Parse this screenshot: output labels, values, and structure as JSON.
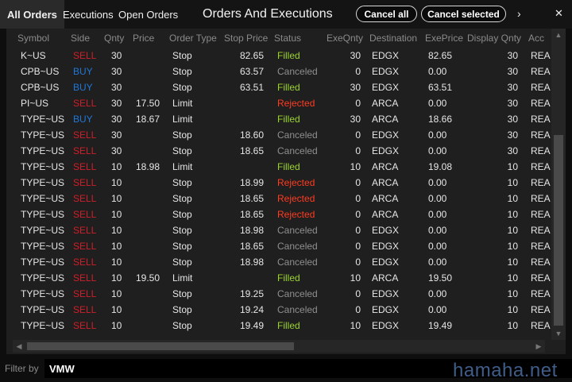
{
  "tabs": [
    {
      "label": "All Orders",
      "active": true
    },
    {
      "label": "Executions",
      "active": false
    },
    {
      "label": "Open Orders",
      "active": false
    }
  ],
  "window_title": "Orders And Executions",
  "actions": {
    "cancel_all": "Cancel all",
    "cancel_selected": "Cancel selected",
    "more_glyph": "›",
    "close_glyph": "✕"
  },
  "columns": [
    "Symbol",
    "Side",
    "Qnty",
    "Price",
    "Order Type",
    "Stop Price",
    "Status",
    "ExeQnty",
    "Destination",
    "ExePrice",
    "Display Qnty",
    "Acc"
  ],
  "rows": [
    {
      "symbol": "K~US",
      "side": "SELL",
      "qnty": "30",
      "price": "",
      "type": "Stop",
      "stop": "82.65",
      "status": "Filled",
      "exeqnty": "30",
      "dest": "EDGX",
      "exeprice": "82.65",
      "display": "30",
      "acc": "REA"
    },
    {
      "symbol": "CPB~US",
      "side": "BUY",
      "qnty": "30",
      "price": "",
      "type": "Stop",
      "stop": "63.57",
      "status": "Canceled",
      "exeqnty": "0",
      "dest": "EDGX",
      "exeprice": "0.00",
      "display": "30",
      "acc": "REA"
    },
    {
      "symbol": "CPB~US",
      "side": "BUY",
      "qnty": "30",
      "price": "",
      "type": "Stop",
      "stop": "63.51",
      "status": "Filled",
      "exeqnty": "30",
      "dest": "EDGX",
      "exeprice": "63.51",
      "display": "30",
      "acc": "REA"
    },
    {
      "symbol": "PI~US",
      "side": "SELL",
      "qnty": "30",
      "price": "17.50",
      "type": "Limit",
      "stop": "",
      "status": "Rejected",
      "exeqnty": "0",
      "dest": "ARCA",
      "exeprice": "0.00",
      "display": "30",
      "acc": "REA"
    },
    {
      "symbol": "TYPE~US",
      "side": "BUY",
      "qnty": "30",
      "price": "18.67",
      "type": "Limit",
      "stop": "",
      "status": "Filled",
      "exeqnty": "30",
      "dest": "ARCA",
      "exeprice": "18.66",
      "display": "30",
      "acc": "REA"
    },
    {
      "symbol": "TYPE~US",
      "side": "SELL",
      "qnty": "30",
      "price": "",
      "type": "Stop",
      "stop": "18.60",
      "status": "Canceled",
      "exeqnty": "0",
      "dest": "EDGX",
      "exeprice": "0.00",
      "display": "30",
      "acc": "REA"
    },
    {
      "symbol": "TYPE~US",
      "side": "SELL",
      "qnty": "30",
      "price": "",
      "type": "Stop",
      "stop": "18.65",
      "status": "Canceled",
      "exeqnty": "0",
      "dest": "EDGX",
      "exeprice": "0.00",
      "display": "30",
      "acc": "REA"
    },
    {
      "symbol": "TYPE~US",
      "side": "SELL",
      "qnty": "10",
      "price": "18.98",
      "type": "Limit",
      "stop": "",
      "status": "Filled",
      "exeqnty": "10",
      "dest": "ARCA",
      "exeprice": "19.08",
      "display": "10",
      "acc": "REA"
    },
    {
      "symbol": "TYPE~US",
      "side": "SELL",
      "qnty": "10",
      "price": "",
      "type": "Stop",
      "stop": "18.99",
      "status": "Rejected",
      "exeqnty": "0",
      "dest": "ARCA",
      "exeprice": "0.00",
      "display": "10",
      "acc": "REA"
    },
    {
      "symbol": "TYPE~US",
      "side": "SELL",
      "qnty": "10",
      "price": "",
      "type": "Stop",
      "stop": "18.65",
      "status": "Rejected",
      "exeqnty": "0",
      "dest": "ARCA",
      "exeprice": "0.00",
      "display": "10",
      "acc": "REA"
    },
    {
      "symbol": "TYPE~US",
      "side": "SELL",
      "qnty": "10",
      "price": "",
      "type": "Stop",
      "stop": "18.65",
      "status": "Rejected",
      "exeqnty": "0",
      "dest": "ARCA",
      "exeprice": "0.00",
      "display": "10",
      "acc": "REA"
    },
    {
      "symbol": "TYPE~US",
      "side": "SELL",
      "qnty": "10",
      "price": "",
      "type": "Stop",
      "stop": "18.98",
      "status": "Canceled",
      "exeqnty": "0",
      "dest": "EDGX",
      "exeprice": "0.00",
      "display": "10",
      "acc": "REA"
    },
    {
      "symbol": "TYPE~US",
      "side": "SELL",
      "qnty": "10",
      "price": "",
      "type": "Stop",
      "stop": "18.65",
      "status": "Canceled",
      "exeqnty": "0",
      "dest": "EDGX",
      "exeprice": "0.00",
      "display": "10",
      "acc": "REA"
    },
    {
      "symbol": "TYPE~US",
      "side": "SELL",
      "qnty": "10",
      "price": "",
      "type": "Stop",
      "stop": "18.98",
      "status": "Canceled",
      "exeqnty": "0",
      "dest": "EDGX",
      "exeprice": "0.00",
      "display": "10",
      "acc": "REA"
    },
    {
      "symbol": "TYPE~US",
      "side": "SELL",
      "qnty": "10",
      "price": "19.50",
      "type": "Limit",
      "stop": "",
      "status": "Filled",
      "exeqnty": "10",
      "dest": "ARCA",
      "exeprice": "19.50",
      "display": "10",
      "acc": "REA"
    },
    {
      "symbol": "TYPE~US",
      "side": "SELL",
      "qnty": "10",
      "price": "",
      "type": "Stop",
      "stop": "19.25",
      "status": "Canceled",
      "exeqnty": "0",
      "dest": "EDGX",
      "exeprice": "0.00",
      "display": "10",
      "acc": "REA"
    },
    {
      "symbol": "TYPE~US",
      "side": "SELL",
      "qnty": "10",
      "price": "",
      "type": "Stop",
      "stop": "19.24",
      "status": "Canceled",
      "exeqnty": "0",
      "dest": "EDGX",
      "exeprice": "0.00",
      "display": "10",
      "acc": "REA"
    },
    {
      "symbol": "TYPE~US",
      "side": "SELL",
      "qnty": "10",
      "price": "",
      "type": "Stop",
      "stop": "19.49",
      "status": "Filled",
      "exeqnty": "10",
      "dest": "EDGX",
      "exeprice": "19.49",
      "display": "10",
      "acc": "REA"
    }
  ],
  "colors": {
    "sell": "#d11e2a",
    "buy": "#1f78d8",
    "filled": "#9bd52c",
    "canceled": "#8f8f8f",
    "rejected": "#ff3b20"
  },
  "filter": {
    "label": "Filter by",
    "value": "VMW"
  },
  "watermark": "hamaha.net"
}
